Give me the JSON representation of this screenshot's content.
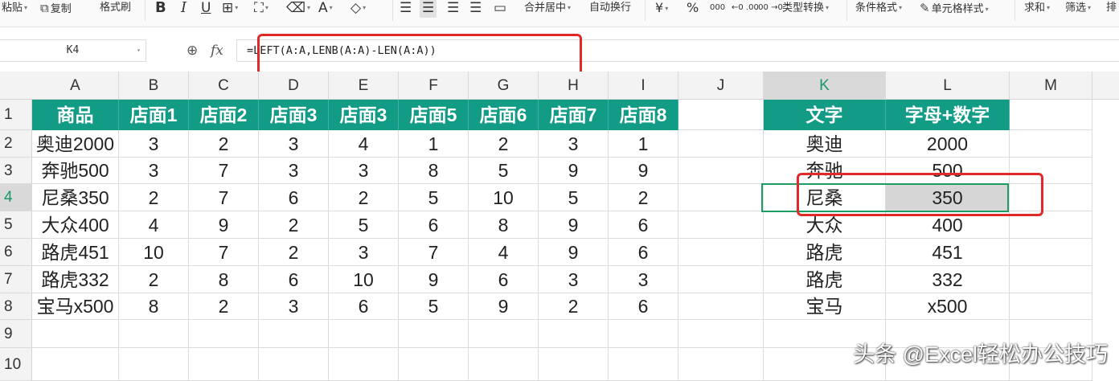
{
  "toolbar": {
    "paste": "粘贴",
    "copy": "复制",
    "format_painter": "格式刷",
    "bold": "B",
    "italic": "I",
    "underline": "U",
    "merge_center": "合并居中",
    "wrap_text": "自动换行",
    "currency": "¥",
    "percent": "%",
    "thousands": "000",
    "dec_increase": "←0 .00",
    "dec_decrease": ".00 →0",
    "type_convert": "类型转换",
    "conditional_format": "条件格式",
    "cell_style": "单元格样式",
    "sum": "求和",
    "filter": "筛选",
    "sort": "排"
  },
  "formula_bar": {
    "name_box": "K4",
    "fx": "fx",
    "formula": "=LEFT(A:A,LENB(A:A)-LEN(A:A))"
  },
  "grid": {
    "columns": [
      "A",
      "B",
      "C",
      "D",
      "E",
      "F",
      "G",
      "H",
      "I",
      "J",
      "K",
      "L",
      "M"
    ],
    "selected_column": "K",
    "rows": [
      "1",
      "2",
      "3",
      "4",
      "5",
      "6",
      "7",
      "8",
      "9",
      "10"
    ],
    "selected_row": "4",
    "table1_headers": [
      "商品",
      "店面1",
      "店面2",
      "店面3",
      "店面3",
      "店面5",
      "店面6",
      "店面7",
      "店面8"
    ],
    "table1_rows": [
      [
        "奥迪2000",
        "3",
        "2",
        "3",
        "4",
        "1",
        "2",
        "3",
        "1"
      ],
      [
        "奔驰500",
        "3",
        "7",
        "3",
        "3",
        "8",
        "5",
        "9",
        "9"
      ],
      [
        "尼桑350",
        "2",
        "7",
        "6",
        "2",
        "5",
        "10",
        "5",
        "2"
      ],
      [
        "大众400",
        "4",
        "9",
        "2",
        "5",
        "6",
        "8",
        "9",
        "6"
      ],
      [
        "路虎451",
        "10",
        "7",
        "2",
        "3",
        "7",
        "4",
        "9",
        "6"
      ],
      [
        "路虎332",
        "2",
        "8",
        "6",
        "10",
        "9",
        "6",
        "3",
        "3"
      ],
      [
        "宝马x500",
        "8",
        "2",
        "3",
        "6",
        "5",
        "9",
        "2",
        "6"
      ]
    ],
    "table2_headers": [
      "文字",
      "字母+数字"
    ],
    "table2_rows": [
      [
        "奥迪",
        "2000"
      ],
      [
        "奔驰",
        "500"
      ],
      [
        "尼桑",
        "350"
      ],
      [
        "大众",
        "400"
      ],
      [
        "路虎",
        "451"
      ],
      [
        "路虎",
        "332"
      ],
      [
        "宝马",
        "x500"
      ]
    ]
  },
  "colors": {
    "header_fill": "#129b85",
    "header_text": "#ffffff",
    "highlight_red": "#e02a2a",
    "selection_green": "#1e9a63"
  },
  "watermark": "头条 @Excel轻松办公技巧"
}
